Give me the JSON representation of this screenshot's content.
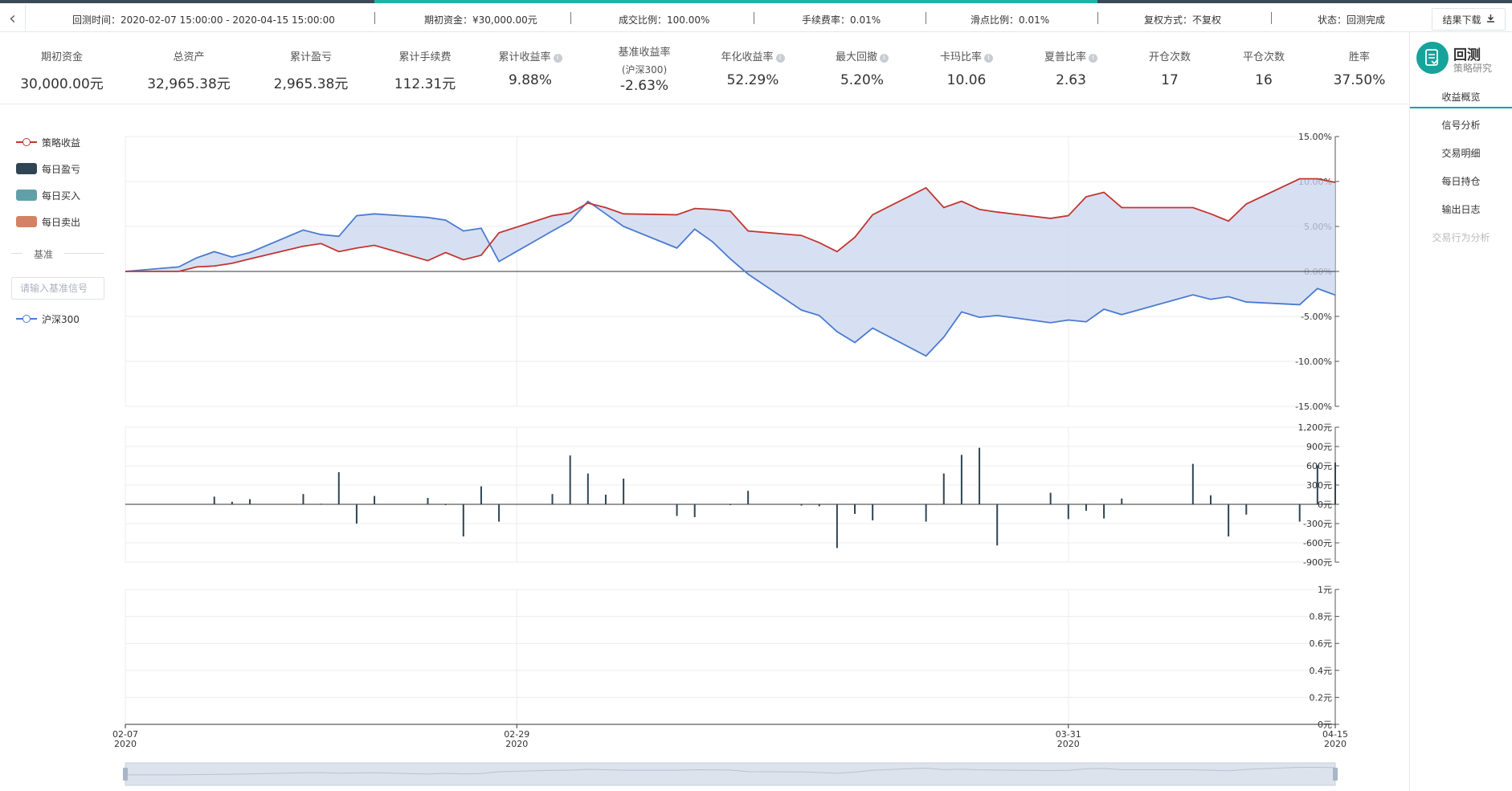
{
  "header": {
    "back_icon": "chevron-left-icon",
    "info": [
      {
        "label": "回测时间：2020-02-07 15:00:00 - 2020-04-15 15:00:00"
      },
      {
        "label": "期初资金：¥30,000.00元"
      },
      {
        "label": "成交比例：100.00%"
      },
      {
        "label": "手续费率：0.01%"
      },
      {
        "label": "滑点比例：0.01%"
      },
      {
        "label": "复权方式：不复权"
      },
      {
        "label": "状态：回测完成"
      }
    ],
    "download_label": "结果下载",
    "download_icon": "download-icon"
  },
  "stats": [
    {
      "label": "期初资金",
      "value": "30,000.00元",
      "help": false
    },
    {
      "label": "总资产",
      "value": "32,965.38元",
      "help": false
    },
    {
      "label": "累计盈亏",
      "value": "2,965.38元",
      "help": false
    },
    {
      "label": "累计手续费",
      "value": "112.31元",
      "help": false
    },
    {
      "label": "累计收益率",
      "value": "9.88%",
      "help": true
    },
    {
      "label": "基准收益率",
      "sub": "(沪深300)",
      "value": "-2.63%",
      "help": false
    },
    {
      "label": "年化收益率",
      "value": "52.29%",
      "help": true
    },
    {
      "label": "最大回撤",
      "value": "5.20%",
      "help": true
    },
    {
      "label": "卡玛比率",
      "value": "10.06",
      "help": true
    },
    {
      "label": "夏普比率",
      "value": "2.63",
      "help": true
    },
    {
      "label": "开仓次数",
      "value": "17",
      "help": false
    },
    {
      "label": "平仓次数",
      "value": "16",
      "help": false
    },
    {
      "label": "胜率",
      "value": "37.50%",
      "help": false
    }
  ],
  "sidebar": {
    "title": "回测",
    "subtitle": "策略研究",
    "items": [
      {
        "label": "收益概览",
        "state": "active"
      },
      {
        "label": "信号分析",
        "state": "normal"
      },
      {
        "label": "交易明细",
        "state": "normal"
      },
      {
        "label": "每日持仓",
        "state": "normal"
      },
      {
        "label": "输出日志",
        "state": "normal"
      },
      {
        "label": "交易行为分析",
        "state": "disabled"
      }
    ]
  },
  "legend": {
    "items": [
      {
        "label": "策略收益",
        "kind": "line",
        "color": "#c23531"
      },
      {
        "label": "每日盈亏",
        "kind": "rect",
        "color": "#2f4554"
      },
      {
        "label": "每日买入",
        "kind": "rect",
        "color": "#61a0a8"
      },
      {
        "label": "每日卖出",
        "kind": "rect",
        "color": "#d48265"
      }
    ],
    "benchmark_heading": "基准",
    "benchmark_placeholder": "请输入基准信号",
    "benchmark_item": {
      "label": "沪深300",
      "kind": "line",
      "color": "#4a7bd0"
    }
  },
  "colors": {
    "strategy": "#c23531",
    "benchmark": "#4a7bd0",
    "area": "#c9d6ee",
    "bars": "#2f4554",
    "accent": "#16a39b"
  },
  "chart_data": [
    {
      "type": "line",
      "x_dates": [
        "2020-02-07",
        "2020-02-10",
        "2020-02-11",
        "2020-02-12",
        "2020-02-13",
        "2020-02-14",
        "2020-02-17",
        "2020-02-18",
        "2020-02-19",
        "2020-02-20",
        "2020-02-21",
        "2020-02-24",
        "2020-02-25",
        "2020-02-26",
        "2020-02-27",
        "2020-02-28",
        "2020-03-02",
        "2020-03-03",
        "2020-03-04",
        "2020-03-05",
        "2020-03-06",
        "2020-03-09",
        "2020-03-10",
        "2020-03-11",
        "2020-03-12",
        "2020-03-13",
        "2020-03-16",
        "2020-03-17",
        "2020-03-18",
        "2020-03-19",
        "2020-03-20",
        "2020-03-23",
        "2020-03-24",
        "2020-03-25",
        "2020-03-26",
        "2020-03-27",
        "2020-03-30",
        "2020-03-31",
        "2020-04-01",
        "2020-04-02",
        "2020-04-03",
        "2020-04-07",
        "2020-04-08",
        "2020-04-09",
        "2020-04-10",
        "2020-04-13",
        "2020-04-14",
        "2020-04-15"
      ],
      "y_min": -15,
      "y_max": 15,
      "y_ticks": [
        "15.00%",
        "10.00%",
        "5.00%",
        "0.00%",
        "-5.00%",
        "-10.00%",
        "-15.00%"
      ],
      "x_tick_labels": [
        {
          "date": "2020-02-07",
          "label": "02-07",
          "year": "2020"
        },
        {
          "date": "2020-02-29",
          "label": "02-29",
          "year": "2020"
        },
        {
          "date": "2020-03-31",
          "label": "03-31",
          "year": "2020"
        },
        {
          "date": "2020-04-15",
          "label": "04-15",
          "year": "2020"
        }
      ],
      "series": [
        {
          "name": "策略收益",
          "points": [
            [
              "2020-02-07",
              0.0
            ],
            [
              "2020-02-10",
              0.0
            ],
            [
              "2020-02-11",
              0.5
            ],
            [
              "2020-02-12",
              0.6
            ],
            [
              "2020-02-13",
              0.9
            ],
            [
              "2020-02-14",
              1.4
            ],
            [
              "2020-02-17",
              2.8
            ],
            [
              "2020-02-18",
              3.1
            ],
            [
              "2020-02-19",
              2.2
            ],
            [
              "2020-02-20",
              2.6
            ],
            [
              "2020-02-21",
              2.9
            ],
            [
              "2020-02-24",
              1.2
            ],
            [
              "2020-02-25",
              2.1
            ],
            [
              "2020-02-26",
              1.3
            ],
            [
              "2020-02-27",
              1.8
            ],
            [
              "2020-02-28",
              4.3
            ],
            [
              "2020-03-02",
              6.2
            ],
            [
              "2020-03-03",
              6.5
            ],
            [
              "2020-03-04",
              7.6
            ],
            [
              "2020-03-05",
              7.1
            ],
            [
              "2020-03-06",
              6.4
            ],
            [
              "2020-03-09",
              6.3
            ],
            [
              "2020-03-10",
              7.0
            ],
            [
              "2020-03-11",
              6.9
            ],
            [
              "2020-03-12",
              6.7
            ],
            [
              "2020-03-13",
              4.5
            ],
            [
              "2020-03-16",
              4.0
            ],
            [
              "2020-03-17",
              3.2
            ],
            [
              "2020-03-18",
              2.2
            ],
            [
              "2020-03-19",
              3.8
            ],
            [
              "2020-03-20",
              6.3
            ],
            [
              "2020-03-23",
              9.3
            ],
            [
              "2020-03-24",
              7.1
            ],
            [
              "2020-03-25",
              7.8
            ],
            [
              "2020-03-26",
              6.9
            ],
            [
              "2020-03-27",
              6.6
            ],
            [
              "2020-03-30",
              5.9
            ],
            [
              "2020-03-31",
              6.2
            ],
            [
              "2020-04-01",
              8.3
            ],
            [
              "2020-04-02",
              8.8
            ],
            [
              "2020-04-03",
              7.1
            ],
            [
              "2020-04-07",
              7.1
            ],
            [
              "2020-04-08",
              6.4
            ],
            [
              "2020-04-09",
              5.6
            ],
            [
              "2020-04-10",
              7.5
            ],
            [
              "2020-04-13",
              10.3
            ],
            [
              "2020-04-14",
              10.3
            ],
            [
              "2020-04-15",
              9.9
            ]
          ]
        },
        {
          "name": "沪深300",
          "points": [
            [
              "2020-02-07",
              0.0
            ],
            [
              "2020-02-10",
              0.5
            ],
            [
              "2020-02-11",
              1.5
            ],
            [
              "2020-02-12",
              2.2
            ],
            [
              "2020-02-13",
              1.6
            ],
            [
              "2020-02-14",
              2.1
            ],
            [
              "2020-02-17",
              4.6
            ],
            [
              "2020-02-18",
              4.1
            ],
            [
              "2020-02-19",
              3.9
            ],
            [
              "2020-02-20",
              6.2
            ],
            [
              "2020-02-21",
              6.4
            ],
            [
              "2020-02-24",
              6.0
            ],
            [
              "2020-02-25",
              5.7
            ],
            [
              "2020-02-26",
              4.5
            ],
            [
              "2020-02-27",
              4.8
            ],
            [
              "2020-02-28",
              1.1
            ],
            [
              "2020-03-02",
              4.5
            ],
            [
              "2020-03-03",
              5.6
            ],
            [
              "2020-03-04",
              7.8
            ],
            [
              "2020-03-05",
              6.4
            ],
            [
              "2020-03-06",
              5.0
            ],
            [
              "2020-03-09",
              2.6
            ],
            [
              "2020-03-10",
              4.7
            ],
            [
              "2020-03-11",
              3.3
            ],
            [
              "2020-03-12",
              1.4
            ],
            [
              "2020-03-13",
              -0.3
            ],
            [
              "2020-03-16",
              -4.3
            ],
            [
              "2020-03-17",
              -4.9
            ],
            [
              "2020-03-18",
              -6.7
            ],
            [
              "2020-03-19",
              -7.9
            ],
            [
              "2020-03-20",
              -6.3
            ],
            [
              "2020-03-23",
              -9.4
            ],
            [
              "2020-03-24",
              -7.3
            ],
            [
              "2020-03-25",
              -4.5
            ],
            [
              "2020-03-26",
              -5.1
            ],
            [
              "2020-03-27",
              -4.9
            ],
            [
              "2020-03-30",
              -5.7
            ],
            [
              "2020-03-31",
              -5.4
            ],
            [
              "2020-04-01",
              -5.6
            ],
            [
              "2020-04-02",
              -4.2
            ],
            [
              "2020-04-03",
              -4.8
            ],
            [
              "2020-04-07",
              -2.6
            ],
            [
              "2020-04-08",
              -3.1
            ],
            [
              "2020-04-09",
              -2.8
            ],
            [
              "2020-04-10",
              -3.4
            ],
            [
              "2020-04-13",
              -3.7
            ],
            [
              "2020-04-14",
              -1.9
            ],
            [
              "2020-04-15",
              -2.63
            ]
          ]
        }
      ]
    },
    {
      "type": "bar",
      "name": "每日盈亏",
      "y_min": -900,
      "y_max": 1200,
      "y_ticks": [
        "1,200元",
        "900元",
        "600元",
        "300元",
        "0元",
        "-300元",
        "-600元",
        "-900元"
      ],
      "points": [
        [
          "2020-02-12",
          120
        ],
        [
          "2020-02-13",
          40
        ],
        [
          "2020-02-14",
          80
        ],
        [
          "2020-02-17",
          160
        ],
        [
          "2020-02-18",
          10
        ],
        [
          "2020-02-19",
          500
        ],
        [
          "2020-02-20",
          -300
        ],
        [
          "2020-02-21",
          130
        ],
        [
          "2020-02-24",
          100
        ],
        [
          "2020-02-25",
          -10
        ],
        [
          "2020-02-26",
          -500
        ],
        [
          "2020-02-27",
          280
        ],
        [
          "2020-02-28",
          -270
        ],
        [
          "2020-03-02",
          160
        ],
        [
          "2020-03-03",
          760
        ],
        [
          "2020-03-04",
          480
        ],
        [
          "2020-03-05",
          150
        ],
        [
          "2020-03-06",
          400
        ],
        [
          "2020-03-09",
          -180
        ],
        [
          "2020-03-10",
          -200
        ],
        [
          "2020-03-12",
          -10
        ],
        [
          "2020-03-13",
          210
        ],
        [
          "2020-03-16",
          -20
        ],
        [
          "2020-03-17",
          -30
        ],
        [
          "2020-03-18",
          -680
        ],
        [
          "2020-03-19",
          -150
        ],
        [
          "2020-03-20",
          -250
        ],
        [
          "2020-03-23",
          -270
        ],
        [
          "2020-03-24",
          480
        ],
        [
          "2020-03-25",
          770
        ],
        [
          "2020-03-26",
          880
        ],
        [
          "2020-03-27",
          -640
        ],
        [
          "2020-03-30",
          180
        ],
        [
          "2020-03-31",
          -230
        ],
        [
          "2020-04-01",
          -100
        ],
        [
          "2020-04-02",
          -220
        ],
        [
          "2020-04-03",
          90
        ],
        [
          "2020-04-07",
          630
        ],
        [
          "2020-04-08",
          140
        ],
        [
          "2020-04-09",
          -500
        ],
        [
          "2020-04-10",
          -160
        ],
        [
          "2020-04-13",
          -270
        ],
        [
          "2020-04-14",
          610
        ],
        [
          "2020-04-15",
          650
        ]
      ]
    },
    {
      "type": "bar",
      "name": "每日买入 / 每日卖出",
      "y_min": 0,
      "y_max": 1,
      "y_ticks": [
        "1元",
        "0.8元",
        "0.6元",
        "0.4元",
        "0.2元",
        "0元"
      ],
      "points": []
    }
  ]
}
